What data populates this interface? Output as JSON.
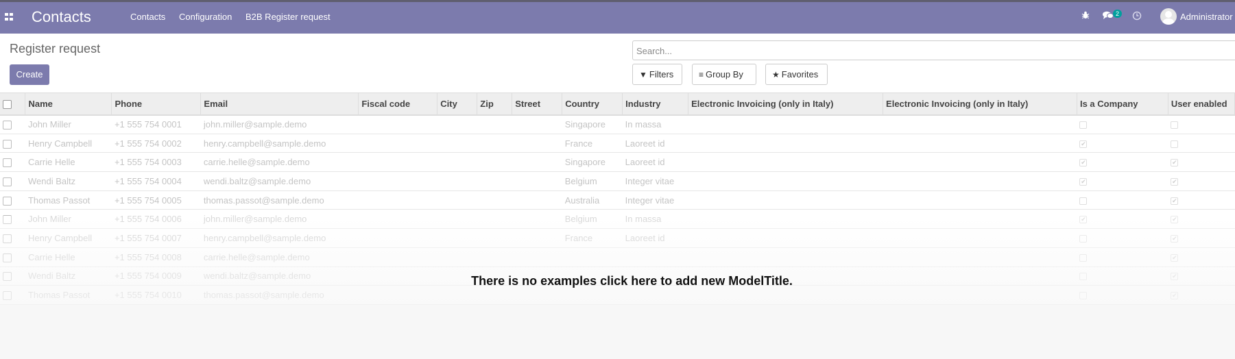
{
  "navbar": {
    "brand": "Contacts",
    "menu": [
      "Contacts",
      "Configuration",
      "B2B Register request"
    ],
    "messages_count": "2",
    "user": "Administrator",
    "icons": [
      "apps-icon",
      "bug-icon",
      "chat-icon",
      "clock-icon"
    ]
  },
  "page": {
    "title": "Register request",
    "create_label": "Create",
    "search_placeholder": "Search...",
    "filters_label": "Filters",
    "groupby_label": "Group By",
    "favorites_label": "Favorites"
  },
  "table": {
    "columns": [
      "Name",
      "Phone",
      "Email",
      "Fiscal code",
      "City",
      "Zip",
      "Street",
      "Country",
      "Industry",
      "Electronic Invoicing (only in Italy)",
      "Electronic Invoicing (only in Italy)",
      "Is a Company",
      "User enabled"
    ],
    "rows": [
      {
        "name": "John Miller",
        "phone": "+1 555 754 0001",
        "email": "john.miller@sample.demo",
        "country": "Singapore",
        "industry": "In massa",
        "company": false,
        "enabled": false
      },
      {
        "name": "Henry Campbell",
        "phone": "+1 555 754 0002",
        "email": "henry.campbell@sample.demo",
        "country": "France",
        "industry": "Laoreet id",
        "company": true,
        "enabled": false
      },
      {
        "name": "Carrie Helle",
        "phone": "+1 555 754 0003",
        "email": "carrie.helle@sample.demo",
        "country": "Singapore",
        "industry": "Laoreet id",
        "company": true,
        "enabled": true
      },
      {
        "name": "Wendi Baltz",
        "phone": "+1 555 754 0004",
        "email": "wendi.baltz@sample.demo",
        "country": "Belgium",
        "industry": "Integer vitae",
        "company": true,
        "enabled": true
      },
      {
        "name": "Thomas Passot",
        "phone": "+1 555 754 0005",
        "email": "thomas.passot@sample.demo",
        "country": "Australia",
        "industry": "Integer vitae",
        "company": false,
        "enabled": true
      },
      {
        "name": "John Miller",
        "phone": "+1 555 754 0006",
        "email": "john.miller@sample.demo",
        "country": "Belgium",
        "industry": "In massa",
        "company": true,
        "enabled": true
      },
      {
        "name": "Henry Campbell",
        "phone": "+1 555 754 0007",
        "email": "henry.campbell@sample.demo",
        "country": "France",
        "industry": "Laoreet id",
        "company": false,
        "enabled": true
      },
      {
        "name": "Carrie Helle",
        "phone": "+1 555 754 0008",
        "email": "carrie.helle@sample.demo",
        "country": "",
        "industry": "",
        "company": false,
        "enabled": true
      },
      {
        "name": "Wendi Baltz",
        "phone": "+1 555 754 0009",
        "email": "wendi.baltz@sample.demo",
        "country": "",
        "industry": "",
        "company": false,
        "enabled": true
      },
      {
        "name": "Thomas Passot",
        "phone": "+1 555 754 0010",
        "email": "thomas.passot@sample.demo",
        "country": "",
        "industry": "",
        "company": false,
        "enabled": true
      }
    ]
  },
  "helper_text": "There is no examples click here to add new ModelTitle.",
  "colors": {
    "navbar": "#7c7bad",
    "badge": "#00a09d"
  }
}
